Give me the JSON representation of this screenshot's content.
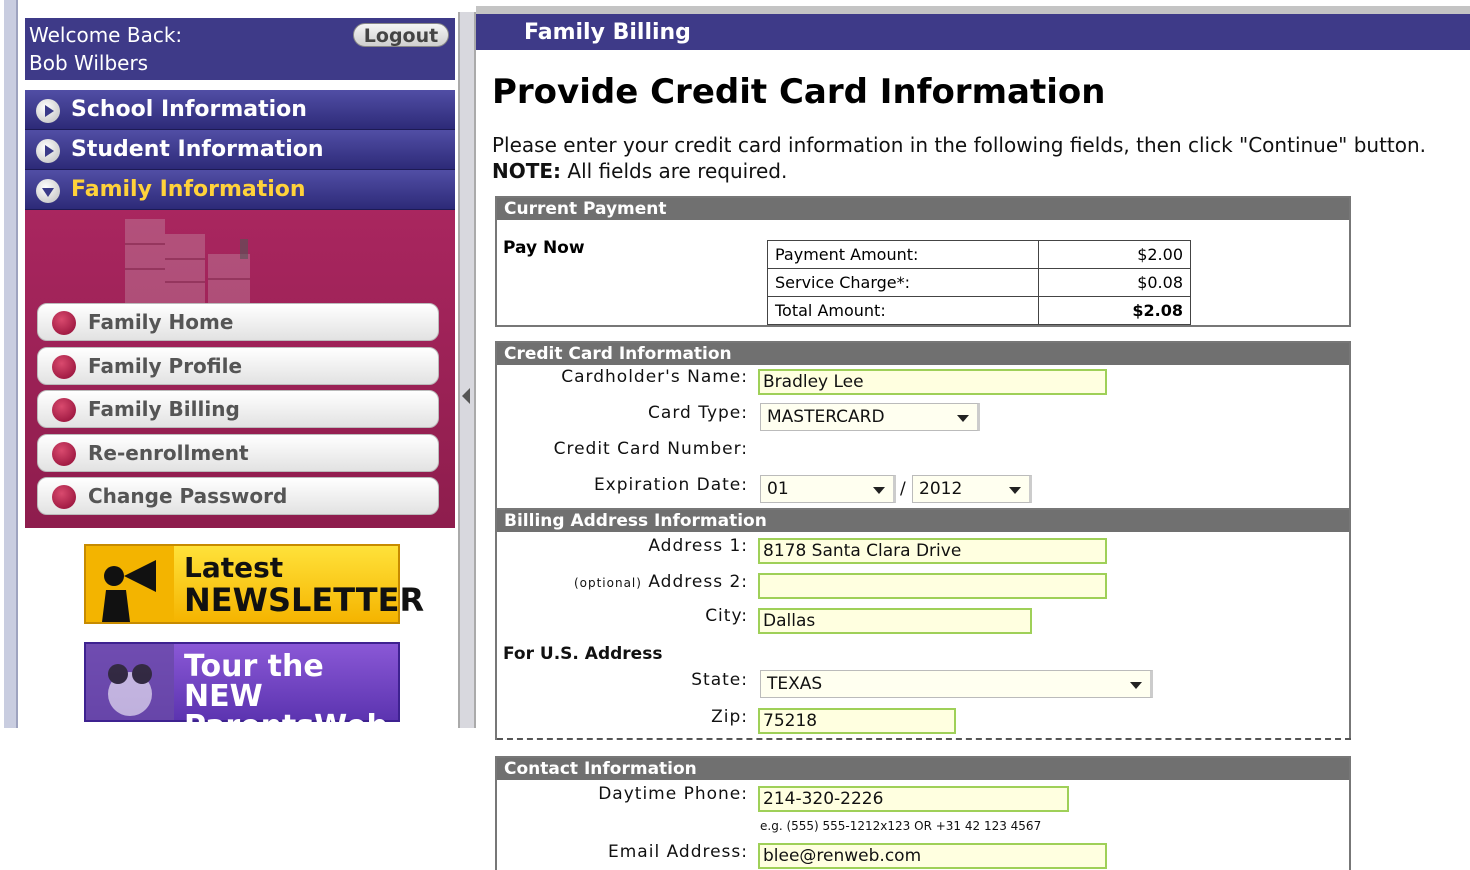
{
  "welcome": {
    "title": "Welcome Back:",
    "user": "Bob Wilbers",
    "logout": "Logout"
  },
  "nav": [
    {
      "label": "School Information"
    },
    {
      "label": "Student Information"
    },
    {
      "label": "Family Information"
    }
  ],
  "family_menu": [
    "Family Home",
    "Family Profile",
    "Family Billing",
    "Re-enrollment",
    "Change Password"
  ],
  "banners": {
    "newsletter": {
      "line1": "Latest",
      "line2": "NEWSLETTER"
    },
    "tour": {
      "line1": "Tour the NEW",
      "line2": "ParentsWeb"
    }
  },
  "header": {
    "title": "Family Billing"
  },
  "page": {
    "title": "Provide Credit Card Information",
    "instruction": "Please enter your credit card information in the following fields, then click \"Continue\" button.",
    "note_label": "NOTE:",
    "note_text": " All fields are required."
  },
  "current_payment": {
    "heading": "Current Payment",
    "pay_now": "Pay Now",
    "rows": [
      {
        "label": "Payment Amount:",
        "value": "$2.00"
      },
      {
        "label": "Service Charge*:",
        "value": "$0.08"
      },
      {
        "label": "Total Amount:",
        "value": "$2.08"
      }
    ]
  },
  "credit_card": {
    "heading": "Credit Card Information",
    "cardholder_label": "Cardholder's Name:",
    "cardholder_value": "Bradley Lee",
    "card_type_label": "Card Type:",
    "card_type_value": "MASTERCARD",
    "number_label": "Credit Card Number:",
    "expiration_label": "Expiration Date:",
    "exp_month": "01",
    "exp_sep": "/",
    "exp_year": "2012"
  },
  "billing": {
    "heading": "Billing Address Information",
    "address1_label": "Address 1:",
    "address1_value": "8178 Santa Clara Drive",
    "optional": "(optional)",
    "address2_label": "Address 2:",
    "address2_value": "",
    "city_label": "City:",
    "city_value": "Dallas",
    "us_label": "For U.S. Address",
    "state_label": "State:",
    "state_value": "TEXAS",
    "zip_label": "Zip:",
    "zip_value": "75218"
  },
  "contact": {
    "heading": "Contact Information",
    "phone_label": "Daytime Phone:",
    "phone_value": "214-320-2226",
    "phone_hint": "e.g. (555) 555-1212x123   OR   +31 42 123 4567",
    "email_label": "Email Address:",
    "email_value": "blee@renweb.com"
  },
  "colors": {
    "header_bg": "#3e3a88",
    "family_panel": "#a9265f",
    "section_head": "#707070",
    "field_border": "#9fd058",
    "field_bg": "#ffffe0"
  },
  "icons": [
    "play-arrow-icon",
    "expand-arrow-icon",
    "bullet-dot-icon",
    "dropdown-caret-icon",
    "collapse-left-icon",
    "file-cabinet-icon",
    "megaphone-icon",
    "binoculars-icon"
  ]
}
